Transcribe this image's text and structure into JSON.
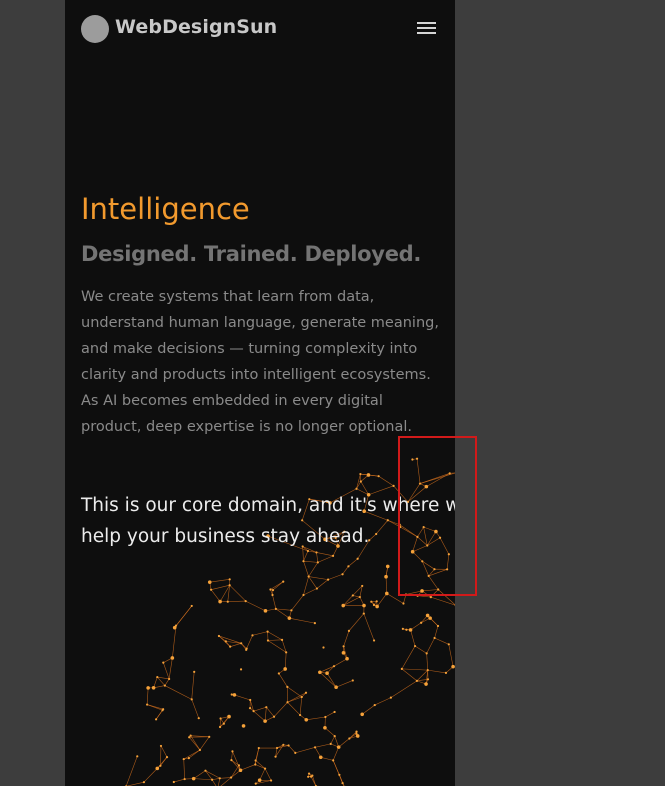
{
  "header": {
    "logo_text": "WebDesignSun",
    "menu_icon": "hamburger-menu-icon"
  },
  "hero": {
    "title": "Intelligence",
    "subtitle": "Designed. Trained. Deployed.",
    "paragraph_1": "We create systems that learn from data, understand human language, generate meaning, and make decisions — turning complexity into clarity and products into intelligent ecosystems.",
    "paragraph_2": "As AI becomes embedded in every digital product, deep expertise is no longer optional.",
    "callout": "This is our core domain, and it's where we help your business stay ahead."
  },
  "colors": {
    "accent": "#f29a2e",
    "background": "#0e0e0e",
    "outer_background": "#3d3d3d",
    "highlight_box": "#d11a1a"
  }
}
